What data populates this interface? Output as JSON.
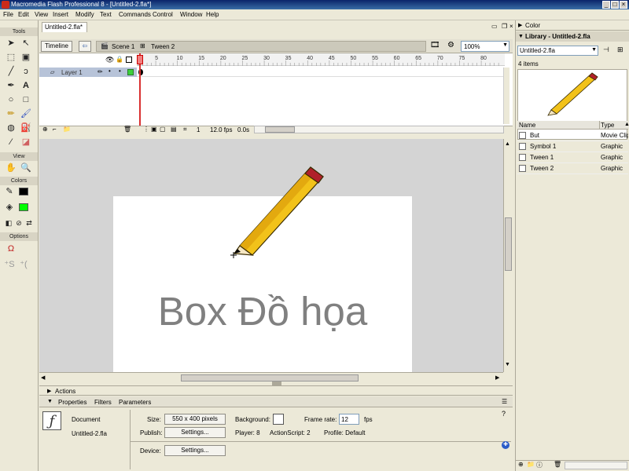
{
  "window": {
    "title": "Macromedia Flash Professional 8 - [Untitled-2.fla*]"
  },
  "menu": [
    "File",
    "Edit",
    "View",
    "Insert",
    "Modify",
    "Text",
    "Commands",
    "Control",
    "Window",
    "Help"
  ],
  "tools": {
    "section_tools": "Tools",
    "section_view": "View",
    "section_colors": "Colors",
    "section_options": "Options"
  },
  "document": {
    "tab": "Untitled-2.fla*"
  },
  "timeline": {
    "label": "Timeline",
    "scene": "Scene 1",
    "symbol": "Tween 2",
    "zoom": "100%",
    "ruler_ticks": [
      "5",
      "10",
      "15",
      "20",
      "25",
      "30",
      "35",
      "40",
      "45",
      "50",
      "55",
      "60",
      "65",
      "70",
      "75",
      "80"
    ],
    "layer_name": "Layer 1",
    "current_frame": "1",
    "fps": "12.0 fps",
    "time": "0.0s"
  },
  "stage": {
    "text": "Box Đồ họa",
    "text_color": "#808080"
  },
  "panels": {
    "actions": "Actions",
    "tabs": [
      "Properties",
      "Filters",
      "Parameters"
    ],
    "properties": {
      "doc_label": "Document",
      "file": "Untitled-2.fla",
      "size_label": "Size:",
      "size_value": "550 x 400 pixels",
      "background_label": "Background:",
      "framerate_label": "Frame rate:",
      "framerate_value": "12",
      "fps_unit": "fps",
      "publish_label": "Publish:",
      "settings_button": "Settings...",
      "player": "Player: 8",
      "actionscript": "ActionScript: 2",
      "profile": "Profile: Default",
      "device_label": "Device:",
      "device_button": "Settings..."
    }
  },
  "right_panel": {
    "color_header": "Color",
    "library_header": "Library - Untitled-2.fla",
    "library_select": "Untitled-2.fla",
    "item_count": "4 items",
    "col_name": "Name",
    "col_type": "Type",
    "items": [
      {
        "name": "But",
        "type": "Movie Clip"
      },
      {
        "name": "Symbol 1",
        "type": "Graphic"
      },
      {
        "name": "Tween 1",
        "type": "Graphic"
      },
      {
        "name": "Tween 2",
        "type": "Graphic"
      }
    ]
  },
  "colors": {
    "stroke": "#000000",
    "fill": "#00ff00",
    "pencil_body": "#f2c21a",
    "pencil_eraser": "#b0202a",
    "titlebar": "#0a246a"
  }
}
